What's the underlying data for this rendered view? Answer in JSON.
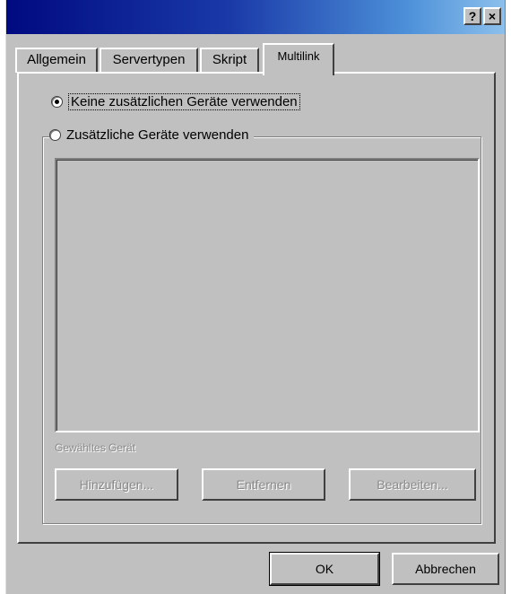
{
  "titlebar": {
    "help_button": "?",
    "close_button": "×"
  },
  "tabs": [
    {
      "label": "Allgemein"
    },
    {
      "label": "Servertypen"
    },
    {
      "label": "Skript"
    },
    {
      "label": "Multilink",
      "active": true
    }
  ],
  "multilink": {
    "option_none": {
      "label": "Keine zusätzlichen Geräte verwenden",
      "selected": true
    },
    "option_additional": {
      "label": "Zusätzliche Geräte verwenden",
      "selected": false
    },
    "selected_device_label": "Gewähltes Gerät",
    "add_button": "Hinzufügen...",
    "remove_button": "Entfernen",
    "edit_button": "Bearbeiten..."
  },
  "footer": {
    "ok_button": "OK",
    "cancel_button": "Abbrechen"
  },
  "colors": {
    "face": "#c0c0c0",
    "title_start": "#000a80",
    "title_end": "#8cc0ec",
    "disabled_text": "#8a8a8a"
  }
}
